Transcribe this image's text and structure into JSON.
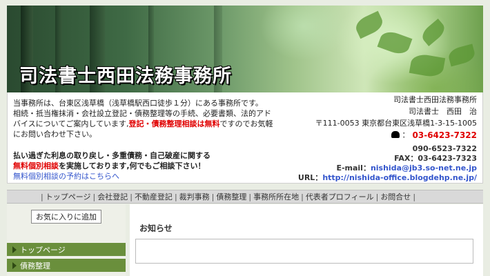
{
  "banner": {
    "title": "司法書士西田法務事務所"
  },
  "intro": {
    "line1": "当事務所は、台東区浅草橋（浅草橋駅西口徒歩１分）にある事務所です。",
    "line2": "相続・抵当権抹消・会社設立登記・債務整理等の手続、必要書類、法的アド",
    "line3_plain": "バイスについてご案内しています,",
    "line3_red": "登記・債務整理相談は無料",
    "line3_tail": "ですのでお気軽",
    "line4": "にお問い合わせ下さい。"
  },
  "promo": {
    "line1": "払い過ぎた利息の取り戻し・多重債務・自己破産に関する",
    "line2_red": "無料個別相談",
    "line2_tail": "を実施しております,何でもご相談下さい！",
    "link": "無料個別相談の予約はこちらへ"
  },
  "contact": {
    "office": "司法書士西田法務事務所",
    "name": "司法書士　西田　治",
    "address": "〒111-0053 東京都台東区浅草橋1-3-15-1005",
    "tel_prefix": "：",
    "tel": "03-6423-7322",
    "mobile": "090-6523-7322",
    "fax": "FAX：03-6423-7323",
    "email_label": "E-mail：",
    "email": "nishida@jb3.so-net.ne.jp",
    "url_label": "URL：",
    "url": "http://nishida-office.blogdehp.ne.jp/"
  },
  "nav": {
    "items": [
      "トップページ",
      "会社登記",
      "不動産登記",
      "裁判事務",
      "債務整理",
      "事務所所在地",
      "代表者プロフィール",
      "お問合せ"
    ]
  },
  "sidebar": {
    "favorite_button": "お気に入りに追加",
    "menu": [
      "トップページ",
      "債務整理"
    ]
  },
  "main": {
    "notice_title": "お知らせ"
  }
}
